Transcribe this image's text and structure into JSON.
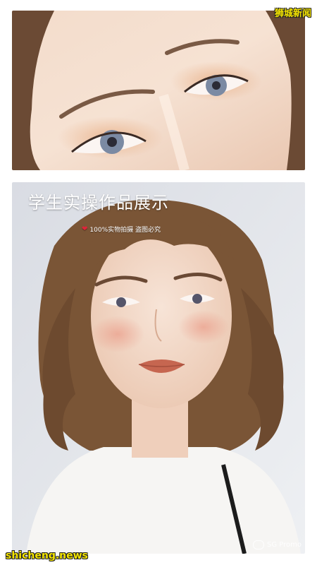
{
  "overlay": {
    "title": "学生实操作品展示",
    "subtitle": "100%实物拍摄 盗图必究",
    "heart_icon": "heart-icon"
  },
  "watermarks": {
    "top_right": "狮城新闻",
    "bottom_left": "shicheng.news",
    "bottom_right": "SG Promo"
  },
  "colors": {
    "brand_yellow": "#f4e400",
    "heart_red": "#e0243a"
  }
}
